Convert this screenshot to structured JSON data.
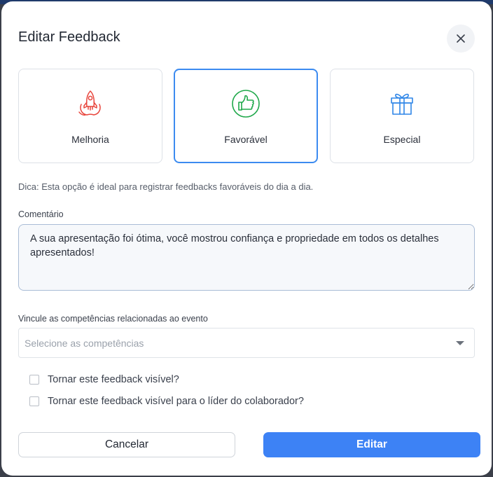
{
  "modal": {
    "title": "Editar Feedback",
    "close_icon": "close-icon"
  },
  "types": [
    {
      "label": "Melhoria",
      "icon": "rocket-icon",
      "color": "#e8453c",
      "selected": false
    },
    {
      "label": "Favorável",
      "icon": "thumbs-up-icon",
      "color": "#1fa84a",
      "selected": true
    },
    {
      "label": "Especial",
      "icon": "gift-icon",
      "color": "#2f86e8",
      "selected": false
    }
  ],
  "hint": "Dica: Esta opção é ideal para registrar feedbacks favoráveis do dia a dia.",
  "comment": {
    "label": "Comentário",
    "value": "A sua apresentação foi ótima, você mostrou confiança e propriedade em todos os detalhes apresentados!"
  },
  "competencies": {
    "label": "Vincule as competências relacionadas ao evento",
    "placeholder": "Selecione as competências"
  },
  "checkboxes": [
    {
      "label": "Tornar este feedback visível?",
      "checked": false
    },
    {
      "label": "Tornar este feedback visível para o líder do colaborador?",
      "checked": false
    }
  ],
  "buttons": {
    "cancel_label": "Cancelar",
    "submit_label": "Editar"
  },
  "colors": {
    "accent": "#3d82f5",
    "selected_border": "#3c8bf0"
  }
}
